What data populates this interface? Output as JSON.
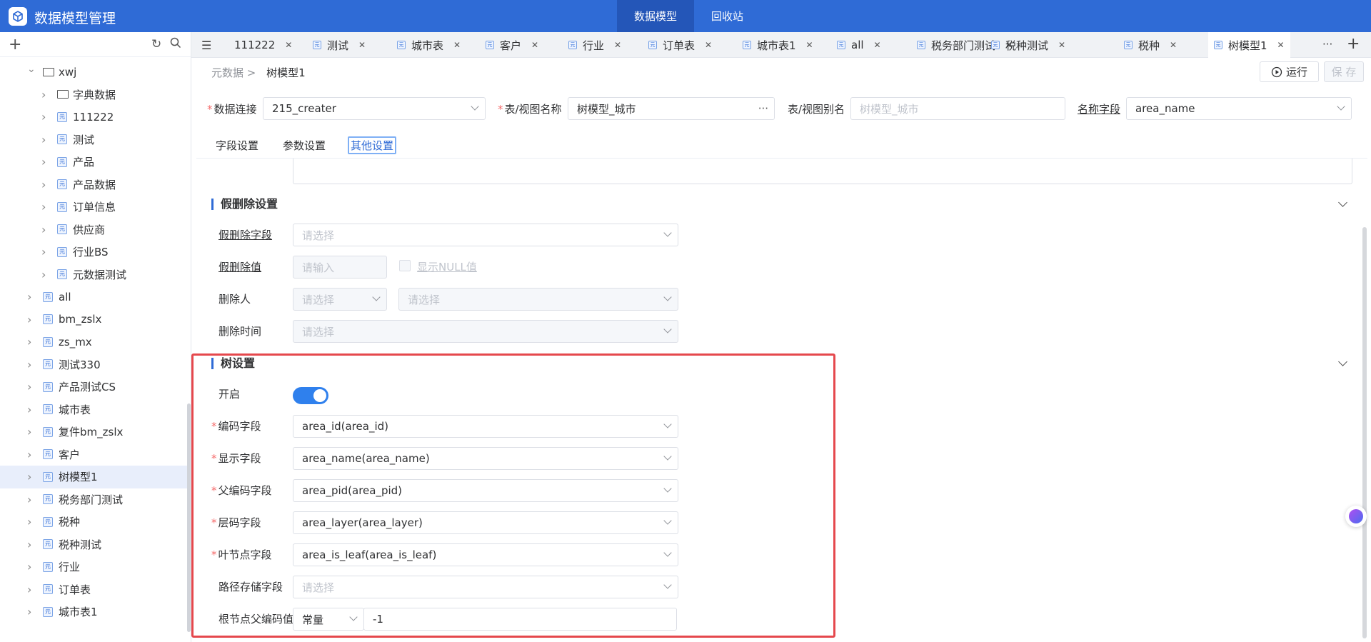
{
  "app": {
    "title": "数据模型管理"
  },
  "topnav": [
    {
      "label": "数据模型"
    },
    {
      "label": "回收站"
    }
  ],
  "sidebar": {
    "tree": [
      {
        "label": "xwj",
        "level": 0,
        "expanded": true,
        "icon": "folder"
      },
      {
        "label": "字典数据",
        "level": 1,
        "icon": "folder"
      },
      {
        "label": "111222",
        "level": 1,
        "icon": "meta"
      },
      {
        "label": "测试",
        "level": 1,
        "icon": "meta"
      },
      {
        "label": "产品",
        "level": 1,
        "icon": "meta"
      },
      {
        "label": "产品数据",
        "level": 1,
        "icon": "meta"
      },
      {
        "label": "订单信息",
        "level": 1,
        "icon": "meta"
      },
      {
        "label": "供应商",
        "level": 1,
        "icon": "meta"
      },
      {
        "label": "行业BS",
        "level": 1,
        "icon": "meta"
      },
      {
        "label": "元数据测试",
        "level": 1,
        "icon": "meta"
      },
      {
        "label": "all",
        "level": 0,
        "icon": "meta"
      },
      {
        "label": "bm_zslx",
        "level": 0,
        "icon": "meta"
      },
      {
        "label": "zs_mx",
        "level": 0,
        "icon": "meta"
      },
      {
        "label": "测试330",
        "level": 0,
        "icon": "meta"
      },
      {
        "label": "产品测试CS",
        "level": 0,
        "icon": "meta"
      },
      {
        "label": "城市表",
        "level": 0,
        "icon": "meta"
      },
      {
        "label": "复件bm_zslx",
        "level": 0,
        "icon": "meta"
      },
      {
        "label": "客户",
        "level": 0,
        "icon": "meta"
      },
      {
        "label": "树模型1",
        "level": 0,
        "icon": "meta",
        "selected": true
      },
      {
        "label": "税务部门测试",
        "level": 0,
        "icon": "meta"
      },
      {
        "label": "税种",
        "level": 0,
        "icon": "meta"
      },
      {
        "label": "税种测试",
        "level": 0,
        "icon": "meta"
      },
      {
        "label": "行业",
        "level": 0,
        "icon": "meta"
      },
      {
        "label": "订单表",
        "level": 0,
        "icon": "meta"
      },
      {
        "label": "城市表1",
        "level": 0,
        "icon": "meta"
      }
    ],
    "meta_icon_glyph": "元"
  },
  "tabs": [
    {
      "label": "111222",
      "icon": false
    },
    {
      "label": "测试",
      "icon": true
    },
    {
      "label": "城市表",
      "icon": true
    },
    {
      "label": "客户",
      "icon": true
    },
    {
      "label": "行业",
      "icon": true
    },
    {
      "label": "订单表",
      "icon": true
    },
    {
      "label": "城市表1",
      "icon": true
    },
    {
      "label": "all",
      "icon": true
    },
    {
      "label": "税务部门测试",
      "icon": true
    },
    {
      "label": "税种测试",
      "icon": true
    },
    {
      "label": "税种",
      "icon": true
    },
    {
      "label": "树模型1",
      "icon": true,
      "active": true
    }
  ],
  "tabs_more": "···",
  "breadcrumb": {
    "parent": "元数据",
    "sep": ">",
    "current": "树模型1"
  },
  "toolbar": {
    "run_label": "运行",
    "save_label": "保 存"
  },
  "form": {
    "connection": {
      "label": "数据连接",
      "value": "215_creater"
    },
    "table_name": {
      "label": "表/视图名称",
      "value": "树模型_城市",
      "more": "···"
    },
    "alias": {
      "label": "表/视图别名",
      "placeholder": "树模型_城市"
    },
    "name_field": {
      "label": "名称字段",
      "value": "area_name"
    }
  },
  "subtabs": [
    {
      "label": "字段设置"
    },
    {
      "label": "参数设置"
    },
    {
      "label": "其他设置",
      "active": true
    }
  ],
  "soft_delete": {
    "title": "假删除设置",
    "field": {
      "label": "假删除字段",
      "placeholder": "请选择"
    },
    "value": {
      "label": "假删除值",
      "placeholder": "请输入"
    },
    "show_null": "显示NULL值",
    "deleter": {
      "label": "删除人",
      "placeholder1": "请选择",
      "placeholder2": "请选择"
    },
    "delete_time": {
      "label": "删除时间",
      "placeholder": "请选择"
    }
  },
  "tree_settings": {
    "title": "树设置",
    "enable": {
      "label": "开启",
      "on": true
    },
    "code_field": {
      "label": "编码字段",
      "value": "area_id(area_id)"
    },
    "display_field": {
      "label": "显示字段",
      "value": "area_name(area_name)"
    },
    "parent_code_field": {
      "label": "父编码字段",
      "value": "area_pid(area_pid)"
    },
    "layer_field": {
      "label": "层码字段",
      "value": "area_layer(area_layer)"
    },
    "leaf_field": {
      "label": "叶节点字段",
      "value": "area_is_leaf(area_is_leaf)"
    },
    "path_field": {
      "label": "路径存储字段",
      "placeholder": "请选择"
    },
    "root_parent_value": {
      "label": "根节点父编码值",
      "type": "常量",
      "value": "-1"
    }
  },
  "colors": {
    "primary": "#2f6bd6",
    "highlight": "#e5484d",
    "required": "#f56c6c"
  }
}
